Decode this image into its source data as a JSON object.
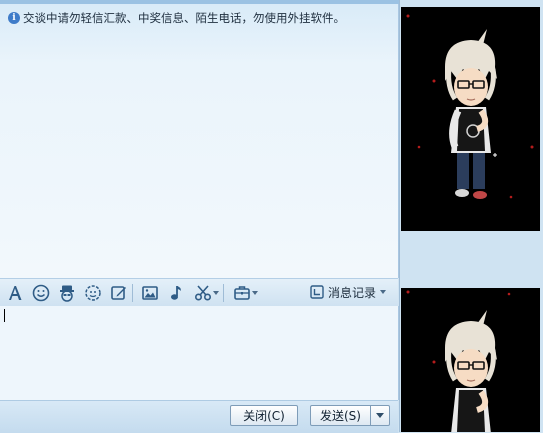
{
  "notice": {
    "icon": "info-icon",
    "text": "交谈中请勿轻信汇款、中奖信息、陌生电话，勿使用外挂软件。"
  },
  "toolbar": {
    "icons": [
      "font-icon",
      "emoji-icon",
      "magic-face-icon",
      "shake-icon",
      "doodle-icon",
      "picture-icon",
      "music-icon",
      "scissors-icon",
      "app-box-icon"
    ],
    "history_label": "消息记录"
  },
  "buttons": {
    "close_label": "关闭(C)",
    "send_label": "发送(S)"
  },
  "colors": {
    "accent": "#3f7cc9",
    "panel_bg": "#cfe3f2",
    "show_bg": "#000000"
  },
  "avatar_show": {
    "top": "qq-show-avatar",
    "bottom": "qq-show-avatar"
  }
}
